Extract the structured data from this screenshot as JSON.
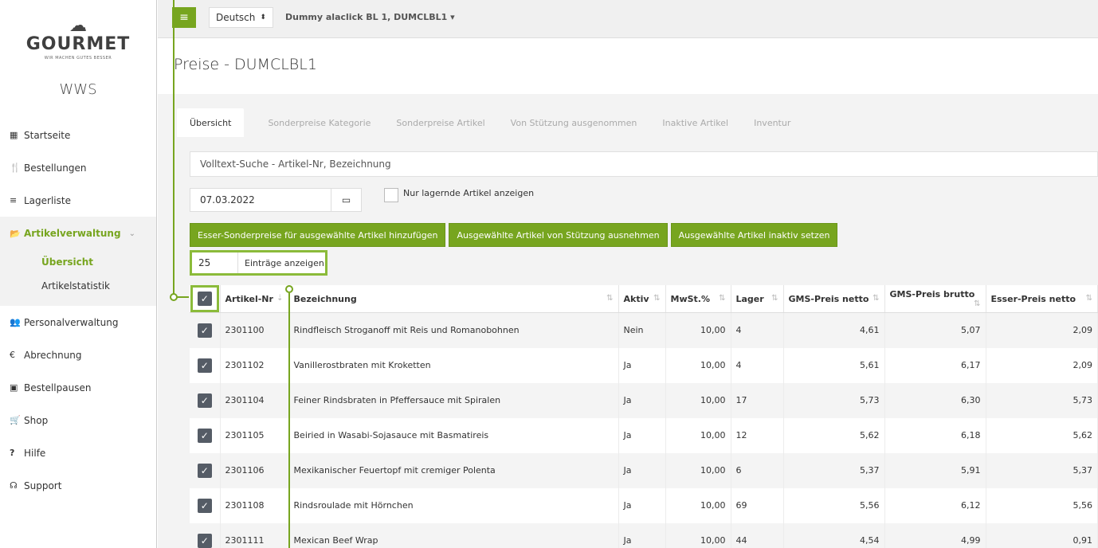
{
  "logo": {
    "name": "GOURMET",
    "tagline": "WIR MACHEN GUTES BESSER"
  },
  "app_name": "WWS",
  "nav": [
    {
      "icon": "grid-icon",
      "glyph": "▦",
      "label": "Startseite"
    },
    {
      "icon": "cutlery-icon",
      "glyph": "🍴",
      "label": "Bestellungen"
    },
    {
      "icon": "list-icon",
      "glyph": "≡",
      "label": "Lagerliste"
    }
  ],
  "nav_active": {
    "label": "Artikelverwaltung",
    "glyph": "📂"
  },
  "subnav": [
    {
      "label": "Übersicht"
    },
    {
      "label": "Artikelstatistik"
    }
  ],
  "nav_bottom": [
    {
      "icon": "users-icon",
      "glyph": "👥",
      "label": "Personalverwaltung"
    },
    {
      "icon": "euro-icon",
      "glyph": "€",
      "label": "Abrechnung"
    },
    {
      "icon": "calendar-icon",
      "glyph": "▣",
      "label": "Bestellpausen"
    },
    {
      "icon": "cart-icon",
      "glyph": "🛒",
      "label": "Shop"
    },
    {
      "icon": "help-icon",
      "glyph": "?",
      "label": "Hilfe"
    },
    {
      "icon": "headset-icon",
      "glyph": "☊",
      "label": "Support"
    }
  ],
  "topbar": {
    "language": "Deutsch",
    "account": "Dummy alaclick BL 1, DUMCLBL1 ▾"
  },
  "page_title": "Preise - DUMCLBL1",
  "tabs": [
    "Übersicht",
    "Sonderpreise Kategorie",
    "Sonderpreise Artikel",
    "Von Stützung ausgenommen",
    "Inaktive Artikel",
    "Inventur"
  ],
  "search": {
    "placeholder": "Volltext-Suche - Artikel-Nr, Bezeichnung"
  },
  "date": "07.03.2022",
  "stock_only_label": "Nur lagernde Artikel anzeigen",
  "buttons": [
    "Esser-Sonderpreise für ausgewählte Artikel hinzufügen",
    "Ausgewählte Artikel von Stützung ausnehmen",
    "Ausgewählte Artikel inaktiv setzen"
  ],
  "entries": {
    "value": "25",
    "label": "Einträge anzeigen"
  },
  "table": {
    "headers": [
      "Artikel-Nr",
      "Bezeichnung",
      "Aktiv",
      "MwSt.%",
      "Lager",
      "GMS-Preis netto",
      "GMS-Preis brutto",
      "Esser-Preis netto"
    ],
    "rows": [
      [
        "2301100",
        "Rindfleisch Stroganoff mit Reis und Romanobohnen",
        "Nein",
        "10,00",
        "4",
        "4,61",
        "5,07",
        "2,09"
      ],
      [
        "2301102",
        "Vanillerostbraten mit Kroketten",
        "Ja",
        "10,00",
        "4",
        "5,61",
        "6,17",
        "2,09"
      ],
      [
        "2301104",
        "Feiner Rindsbraten in Pfeffersauce mit Spiralen",
        "Ja",
        "10,00",
        "17",
        "5,73",
        "6,30",
        "5,73"
      ],
      [
        "2301105",
        "Beiried in Wasabi-Sojasauce mit Basmatireis",
        "Ja",
        "10,00",
        "12",
        "5,62",
        "6,18",
        "5,62"
      ],
      [
        "2301106",
        "Mexikanischer Feuertopf mit cremiger Polenta",
        "Ja",
        "10,00",
        "6",
        "5,37",
        "5,91",
        "5,37"
      ],
      [
        "2301108",
        "Rindsroulade mit Hörnchen",
        "Ja",
        "10,00",
        "69",
        "5,56",
        "6,12",
        "5,56"
      ],
      [
        "2301111",
        "Mexican Beef Wrap",
        "Ja",
        "10,00",
        "44",
        "4,54",
        "4,99",
        "0,91"
      ]
    ]
  }
}
